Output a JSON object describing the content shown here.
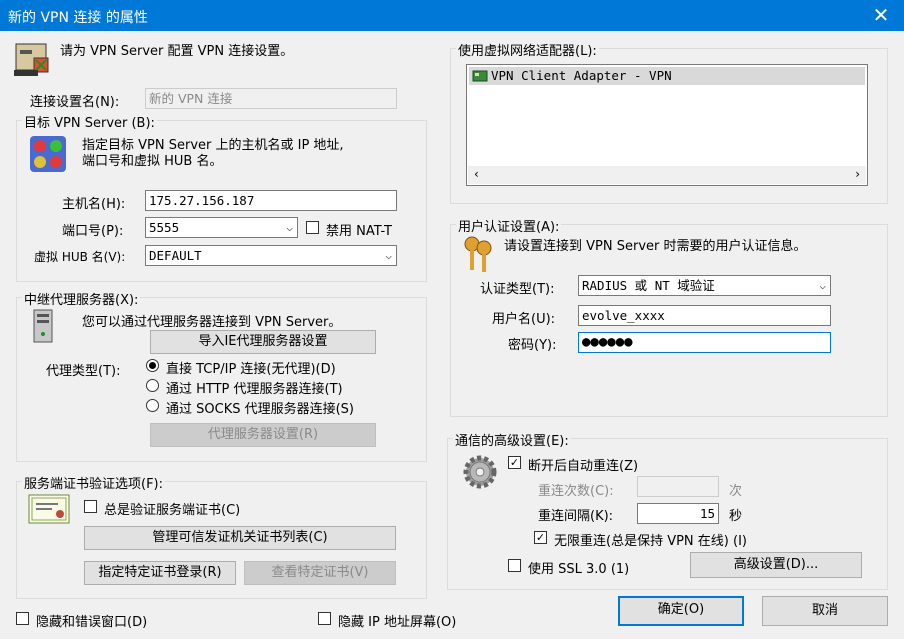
{
  "window": {
    "title": "新的 VPN 连接 的属性",
    "close_glyph": "✕"
  },
  "intro": "请为 VPN Server 配置 VPN 连接设置。",
  "conn_name": {
    "label": "连接设置名(N):",
    "placeholder": "新的 VPN 连接"
  },
  "target": {
    "group": "目标 VPN Server (B):",
    "desc_line1": "指定目标 VPN Server 上的主机名或 IP 地址,",
    "desc_line2": "端口号和虚拟 HUB 名。",
    "host_label": "主机名(H):",
    "host_value": "175.27.156.187",
    "port_label": "端口号(P):",
    "port_value": "5555",
    "natt_label": "禁用 NAT-T",
    "hub_label": "虚拟 HUB 名(V):",
    "hub_value": "DEFAULT"
  },
  "proxy": {
    "group": "中继代理服务器(X):",
    "desc": "您可以通过代理服务器连接到 VPN Server。",
    "import_button": "导入IE代理服务器设置",
    "type_label": "代理类型(T):",
    "options": [
      "直接 TCP/IP 连接(无代理)(D)",
      "通过 HTTP 代理服务器连接(T)",
      "通过 SOCKS 代理服务器连接(S)"
    ],
    "settings_button": "代理服务器设置(R)"
  },
  "cert": {
    "group": "服务端证书验证选项(F):",
    "always_verify": "总是验证服务端证书(C)",
    "trusted_ca_button": "管理可信发证机关证书列表(C)",
    "specify_button": "指定特定证书登录(R)",
    "view_button": "查看特定证书(V)"
  },
  "adapter": {
    "group": "使用虚拟网络适配器(L):",
    "items": [
      "VPN Client Adapter - VPN"
    ]
  },
  "auth": {
    "group": "用户认证设置(A):",
    "desc": "请设置连接到 VPN Server 时需要的用户认证信息。",
    "type_label": "认证类型(T):",
    "type_value": "RADIUS 或 NT 域验证",
    "user_label": "用户名(U):",
    "user_value": "evolve_xxxx",
    "pass_label": "密码(Y):",
    "pass_value": "●●●●●●"
  },
  "advanced": {
    "group": "通信的高级设置(E):",
    "auto_reconnect": "断开后自动重连(Z)",
    "retry_count_label": "重连次数(C):",
    "retry_count_unit": "次",
    "retry_interval_label": "重连间隔(K):",
    "retry_interval_value": "15",
    "retry_interval_unit": "秒",
    "infinite": "无限重连(总是保持 VPN 在线) (I)",
    "ssl3": "使用 SSL 3.0 (1)",
    "advanced_button": "高级设置(D)..."
  },
  "bottom": {
    "hide_errors": "隐藏和错误窗口(D)",
    "hide_ip": "隐藏 IP 地址屏幕(O)",
    "ok": "确定(O)",
    "cancel": "取消"
  }
}
